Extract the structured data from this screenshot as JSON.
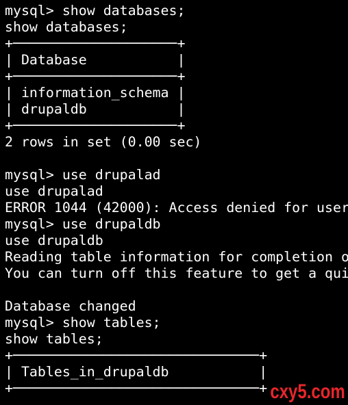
{
  "terminal": {
    "background": "#000000",
    "foreground": "#ffffff",
    "lines": [
      "mysql> show databases;",
      "show databases;",
      "+────────────────────+",
      "| Database           |",
      "+────────────────────+",
      "| information_schema |",
      "| drupaldb           |",
      "+────────────────────+",
      "2 rows in set (0.00 sec)",
      "",
      "mysql> use drupalad",
      "use drupalad",
      "ERROR 1044 (42000): Access denied for user",
      "mysql> use drupaldb",
      "use drupaldb",
      "Reading table information for completion of",
      "You can turn off this feature to get a quic",
      "",
      "Database changed",
      "mysql> show tables;",
      "show tables;",
      "+──────────────────────────────+",
      "| Tables_in_drupaldb           |",
      "+──────────────────────────────+"
    ]
  },
  "watermark": {
    "text": "cxy5.com",
    "color": "#e8262b"
  }
}
